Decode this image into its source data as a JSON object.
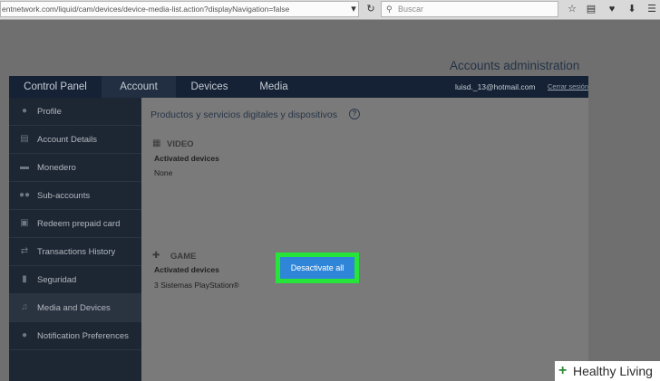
{
  "browser": {
    "url": "entnetwork.com/liquid/cam/devices/device-media-list.action?displayNavigation=false",
    "search_placeholder": "Buscar"
  },
  "page": {
    "title": "Accounts administration"
  },
  "topnav": {
    "tabs": [
      {
        "label": "Control Panel"
      },
      {
        "label": "Account"
      },
      {
        "label": "Devices"
      },
      {
        "label": "Media"
      }
    ],
    "user_email": "luisd._13@hotmail.com",
    "logout_label": "Cerrar sesión"
  },
  "sidebar": {
    "items": [
      {
        "label": "Profile",
        "icon": "user-icon"
      },
      {
        "label": "Account Details",
        "icon": "document-icon"
      },
      {
        "label": "Monedero",
        "icon": "wallet-icon"
      },
      {
        "label": "Sub-accounts",
        "icon": "users-icon"
      },
      {
        "label": "Redeem prepaid card",
        "icon": "gift-icon"
      },
      {
        "label": "Transactions History",
        "icon": "transfer-icon"
      },
      {
        "label": "Seguridad",
        "icon": "lock-icon"
      },
      {
        "label": "Media and Devices",
        "icon": "media-icon"
      },
      {
        "label": "Notification Preferences",
        "icon": "bell-icon"
      }
    ]
  },
  "content": {
    "heading": "Productos y servicios digitales y dispositivos",
    "help_symbol": "?",
    "categories": [
      {
        "title": "VIDEO",
        "sub": "Activated devices",
        "value": "None"
      },
      {
        "title": "GAME",
        "sub": "Activated devices",
        "value": "3 Sistemas PlayStation®"
      }
    ],
    "deactivate_label": "Desactivate all"
  },
  "watermark": {
    "text": "Healthy Living",
    "symbol": "+"
  }
}
